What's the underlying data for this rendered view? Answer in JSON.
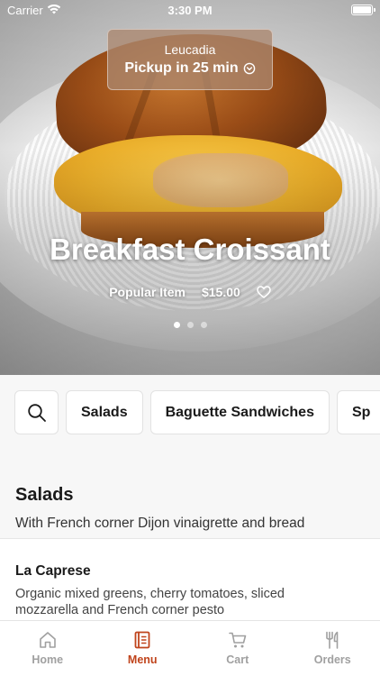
{
  "status_bar": {
    "carrier": "Carrier",
    "time": "3:30 PM"
  },
  "location": {
    "name": "Leucadia",
    "pickup": "Pickup in 25 min"
  },
  "hero": {
    "title": "Breakfast Croissant",
    "tag": "Popular Item",
    "price": "$15.00",
    "carousel_pages": 3,
    "carousel_active": 1
  },
  "categories": [
    "Salads",
    "Baguette Sandwiches",
    "Sp"
  ],
  "section": {
    "title": "Salads",
    "description": "With French corner Dijon vinaigrette and bread"
  },
  "item": {
    "name": "La Caprese",
    "description": "Organic mixed greens, cherry tomatoes, sliced mozzarella and French corner pesto"
  },
  "tabs": [
    {
      "label": "Home",
      "icon": "home-icon",
      "active": false
    },
    {
      "label": "Menu",
      "icon": "menu-book-icon",
      "active": true
    },
    {
      "label": "Cart",
      "icon": "cart-icon",
      "active": false
    },
    {
      "label": "Orders",
      "icon": "utensils-icon",
      "active": false
    }
  ],
  "colors": {
    "accent": "#c0441c",
    "inactive_tab": "#a0a0a0",
    "pill_bg": "#aa876e"
  }
}
